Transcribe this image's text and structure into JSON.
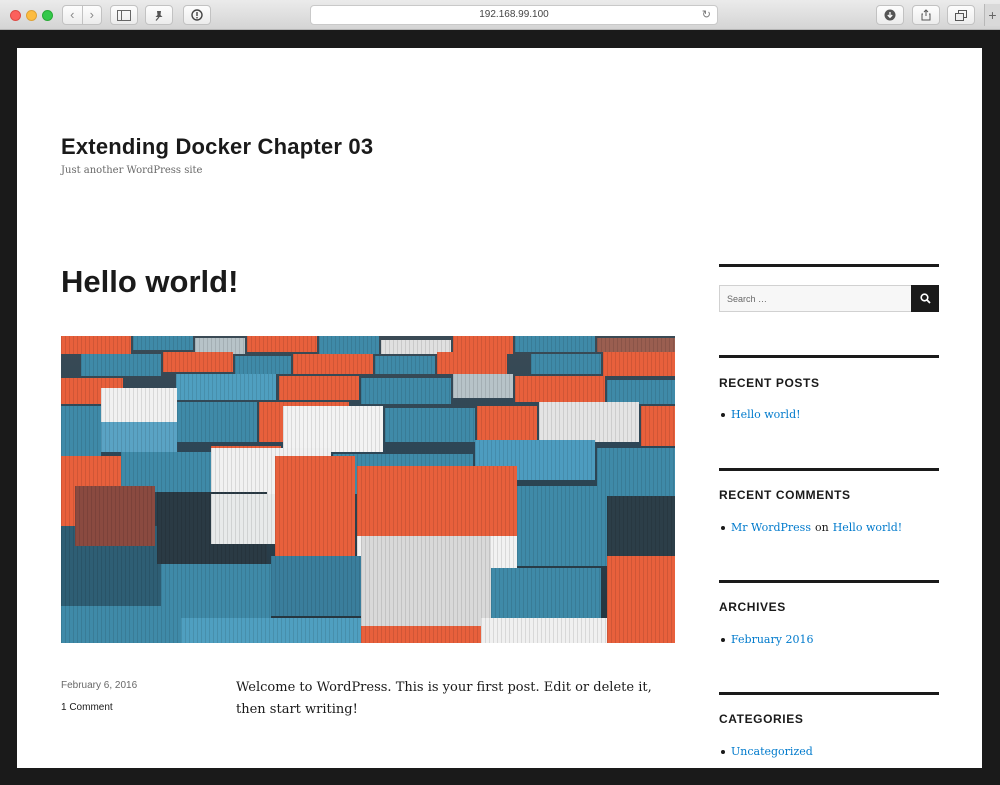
{
  "browser": {
    "url": "192.168.99.100"
  },
  "site": {
    "title": "Extending Docker Chapter 03",
    "description": "Just another WordPress site"
  },
  "post": {
    "title": "Hello world!",
    "date": "February 6, 2016",
    "comments_link": "1 Comment",
    "body": "Welcome to WordPress. This is your first post. Edit or delete it, then start writing!"
  },
  "sidebar": {
    "search_placeholder": "Search …",
    "recent_posts": {
      "title": "RECENT POSTS",
      "items": [
        "Hello world!"
      ]
    },
    "recent_comments": {
      "title": "RECENT COMMENTS",
      "author": "Mr WordPress",
      "on": "on",
      "post": "Hello world!"
    },
    "archives": {
      "title": "ARCHIVES",
      "items": [
        "February 2016"
      ]
    },
    "categories": {
      "title": "CATEGORIES",
      "items": [
        "Uncategorized"
      ]
    }
  },
  "colors": {
    "link": "#007acc",
    "text": "#1a1a1a",
    "container_orange": "#e8603c",
    "container_teal": "#3f8aa8"
  }
}
